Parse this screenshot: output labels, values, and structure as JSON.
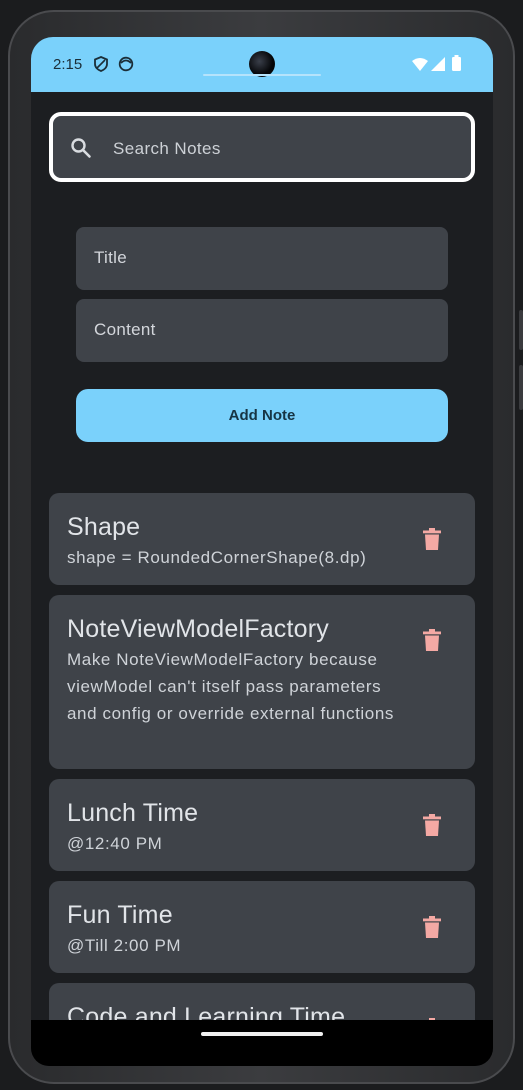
{
  "status_bar": {
    "time": "2:15",
    "background": "#7ad1fb",
    "icons": [
      "shield-icon",
      "face-icon",
      "wifi-icon",
      "signal-icon",
      "battery-icon"
    ]
  },
  "search": {
    "placeholder": "Search Notes",
    "icon": "search-icon"
  },
  "form": {
    "title_placeholder": "Title",
    "content_placeholder": "Content",
    "add_button_label": "Add Note",
    "accent_color": "#7ad1fb"
  },
  "notes": [
    {
      "title": "Shape",
      "content": "shape = RoundedCornerShape(8.dp)"
    },
    {
      "title": "NoteViewModelFactory",
      "content": "Make NoteViewModelFactory because viewModel can't itself pass parameters and config or override external functions"
    },
    {
      "title": "Lunch Time",
      "content": "@12:40 PM"
    },
    {
      "title": "Fun Time",
      "content": "@Till 2:00 PM"
    },
    {
      "title": "Code and Learning Time",
      "content": ""
    }
  ],
  "colors": {
    "card": "#3f4349",
    "trash": "#f4a9a4",
    "background": "#1c1e21"
  }
}
